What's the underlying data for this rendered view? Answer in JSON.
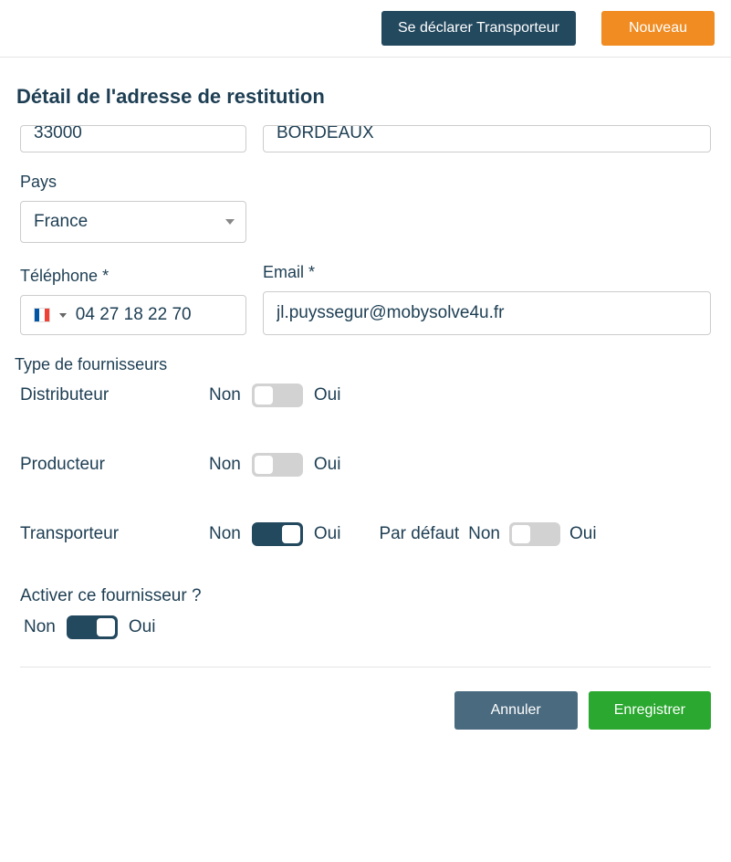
{
  "header": {
    "declare_carrier_label": "Se déclarer Transporteur",
    "new_label": "Nouveau"
  },
  "page_title": "Détail de l'adresse de restitution",
  "address": {
    "postal_code": "33000",
    "city": "BORDEAUX"
  },
  "country": {
    "label": "Pays",
    "value": "France"
  },
  "phone": {
    "label": "Téléphone *",
    "value": "04 27 18 22 70",
    "country_flag": "fr"
  },
  "email": {
    "label": "Email *",
    "value": "jl.puyssegur@mobysolve4u.fr"
  },
  "supplier_types": {
    "section_label": "Type de fournisseurs",
    "off_label": "Non",
    "on_label": "Oui",
    "default_label": "Par défaut",
    "distributor": {
      "label": "Distributeur",
      "value": false
    },
    "producer": {
      "label": "Producteur",
      "value": false
    },
    "carrier": {
      "label": "Transporteur",
      "value": true,
      "default": false
    }
  },
  "activate": {
    "label": "Activer ce fournisseur ?",
    "off_label": "Non",
    "on_label": "Oui",
    "value": true
  },
  "footer": {
    "cancel_label": "Annuler",
    "save_label": "Enregistrer"
  }
}
